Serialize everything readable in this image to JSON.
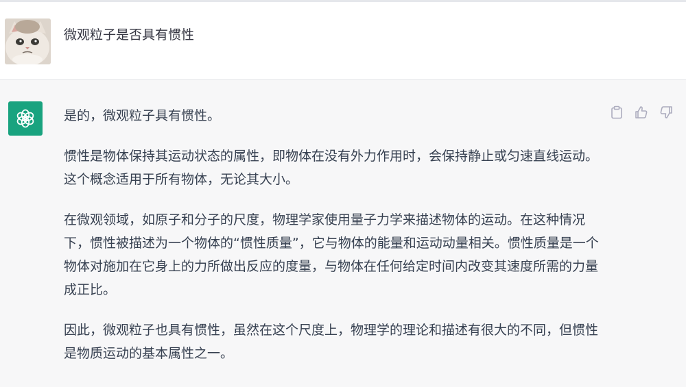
{
  "user_message": {
    "text": "微观粒子是否具有惯性"
  },
  "assistant_message": {
    "paragraphs": [
      "是的，微观粒子具有惯性。",
      "惯性是物体保持其运动状态的属性，即物体在没有外力作用时，会保持静止或匀速直线运动。这个概念适用于所有物体，无论其大小。",
      "在微观领域，如原子和分子的尺度，物理学家使用量子力学来描述物体的运动。在这种情况下，惯性被描述为一个物体的“惯性质量”，它与物体的能量和运动动量相关。惯性质量是一个物体对施加在它身上的力所做出反应的度量，与物体在任何给定时间内改变其速度所需的力量成正比。",
      "因此，微观粒子也具有惯性，虽然在这个尺度上，物理学的理论和描述有很大的不同，但惯性是物质运动的基本属性之一。"
    ]
  },
  "icons": {
    "user_avatar": "cat-avatar",
    "assistant_avatar": "openai-logo-icon",
    "actions": [
      "clipboard-icon",
      "thumbs-up-icon",
      "thumbs-down-icon"
    ]
  },
  "colors": {
    "assistant_bg": "#f7f7f8",
    "gpt_avatar_bg": "#19a37f",
    "text": "#374151",
    "icon": "#acacbe"
  }
}
